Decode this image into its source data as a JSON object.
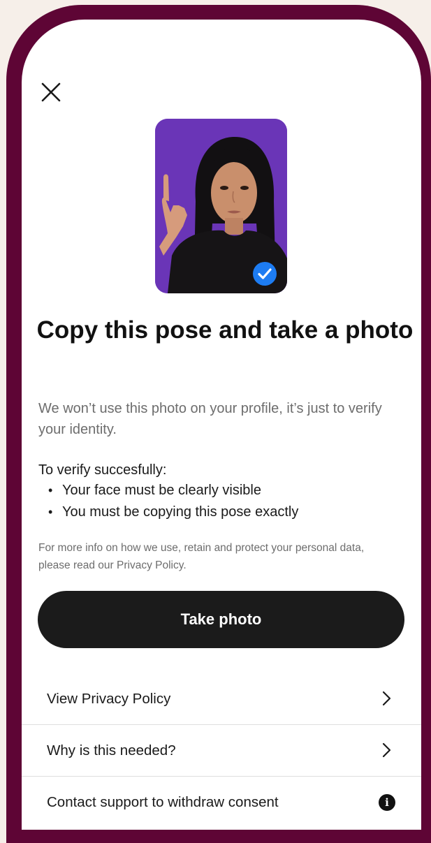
{
  "icons": {
    "close": "close-icon",
    "verified": "check-badge-icon",
    "chevron": "chevron-right-icon",
    "info": "info-icon"
  },
  "colors": {
    "frame": "#5e0535",
    "background": "#f6efe9",
    "hero_background": "#6a35b7",
    "verified_badge": "#1d7cf2",
    "primary_button": "#1b1b1b"
  },
  "header": {
    "title": "Copy this pose and take a photo"
  },
  "content": {
    "subtitle": "We won’t use this photo on your profile, it’s just to verify your identity.",
    "requirements_heading": "To verify succesfully:",
    "requirements": [
      "Your face must be clearly visible",
      "You must be copying this pose exactly"
    ],
    "footnote": "For more info on how we use, retain and protect your personal data, please read our Privacy Policy."
  },
  "primary_action": {
    "label": "Take photo"
  },
  "menu": [
    {
      "label": "View Privacy Policy",
      "icon": "chevron-right-icon"
    },
    {
      "label": "Why is this needed?",
      "icon": "chevron-right-icon"
    },
    {
      "label": "Contact support to withdraw consent",
      "icon": "info-icon",
      "glyph": "i"
    }
  ]
}
